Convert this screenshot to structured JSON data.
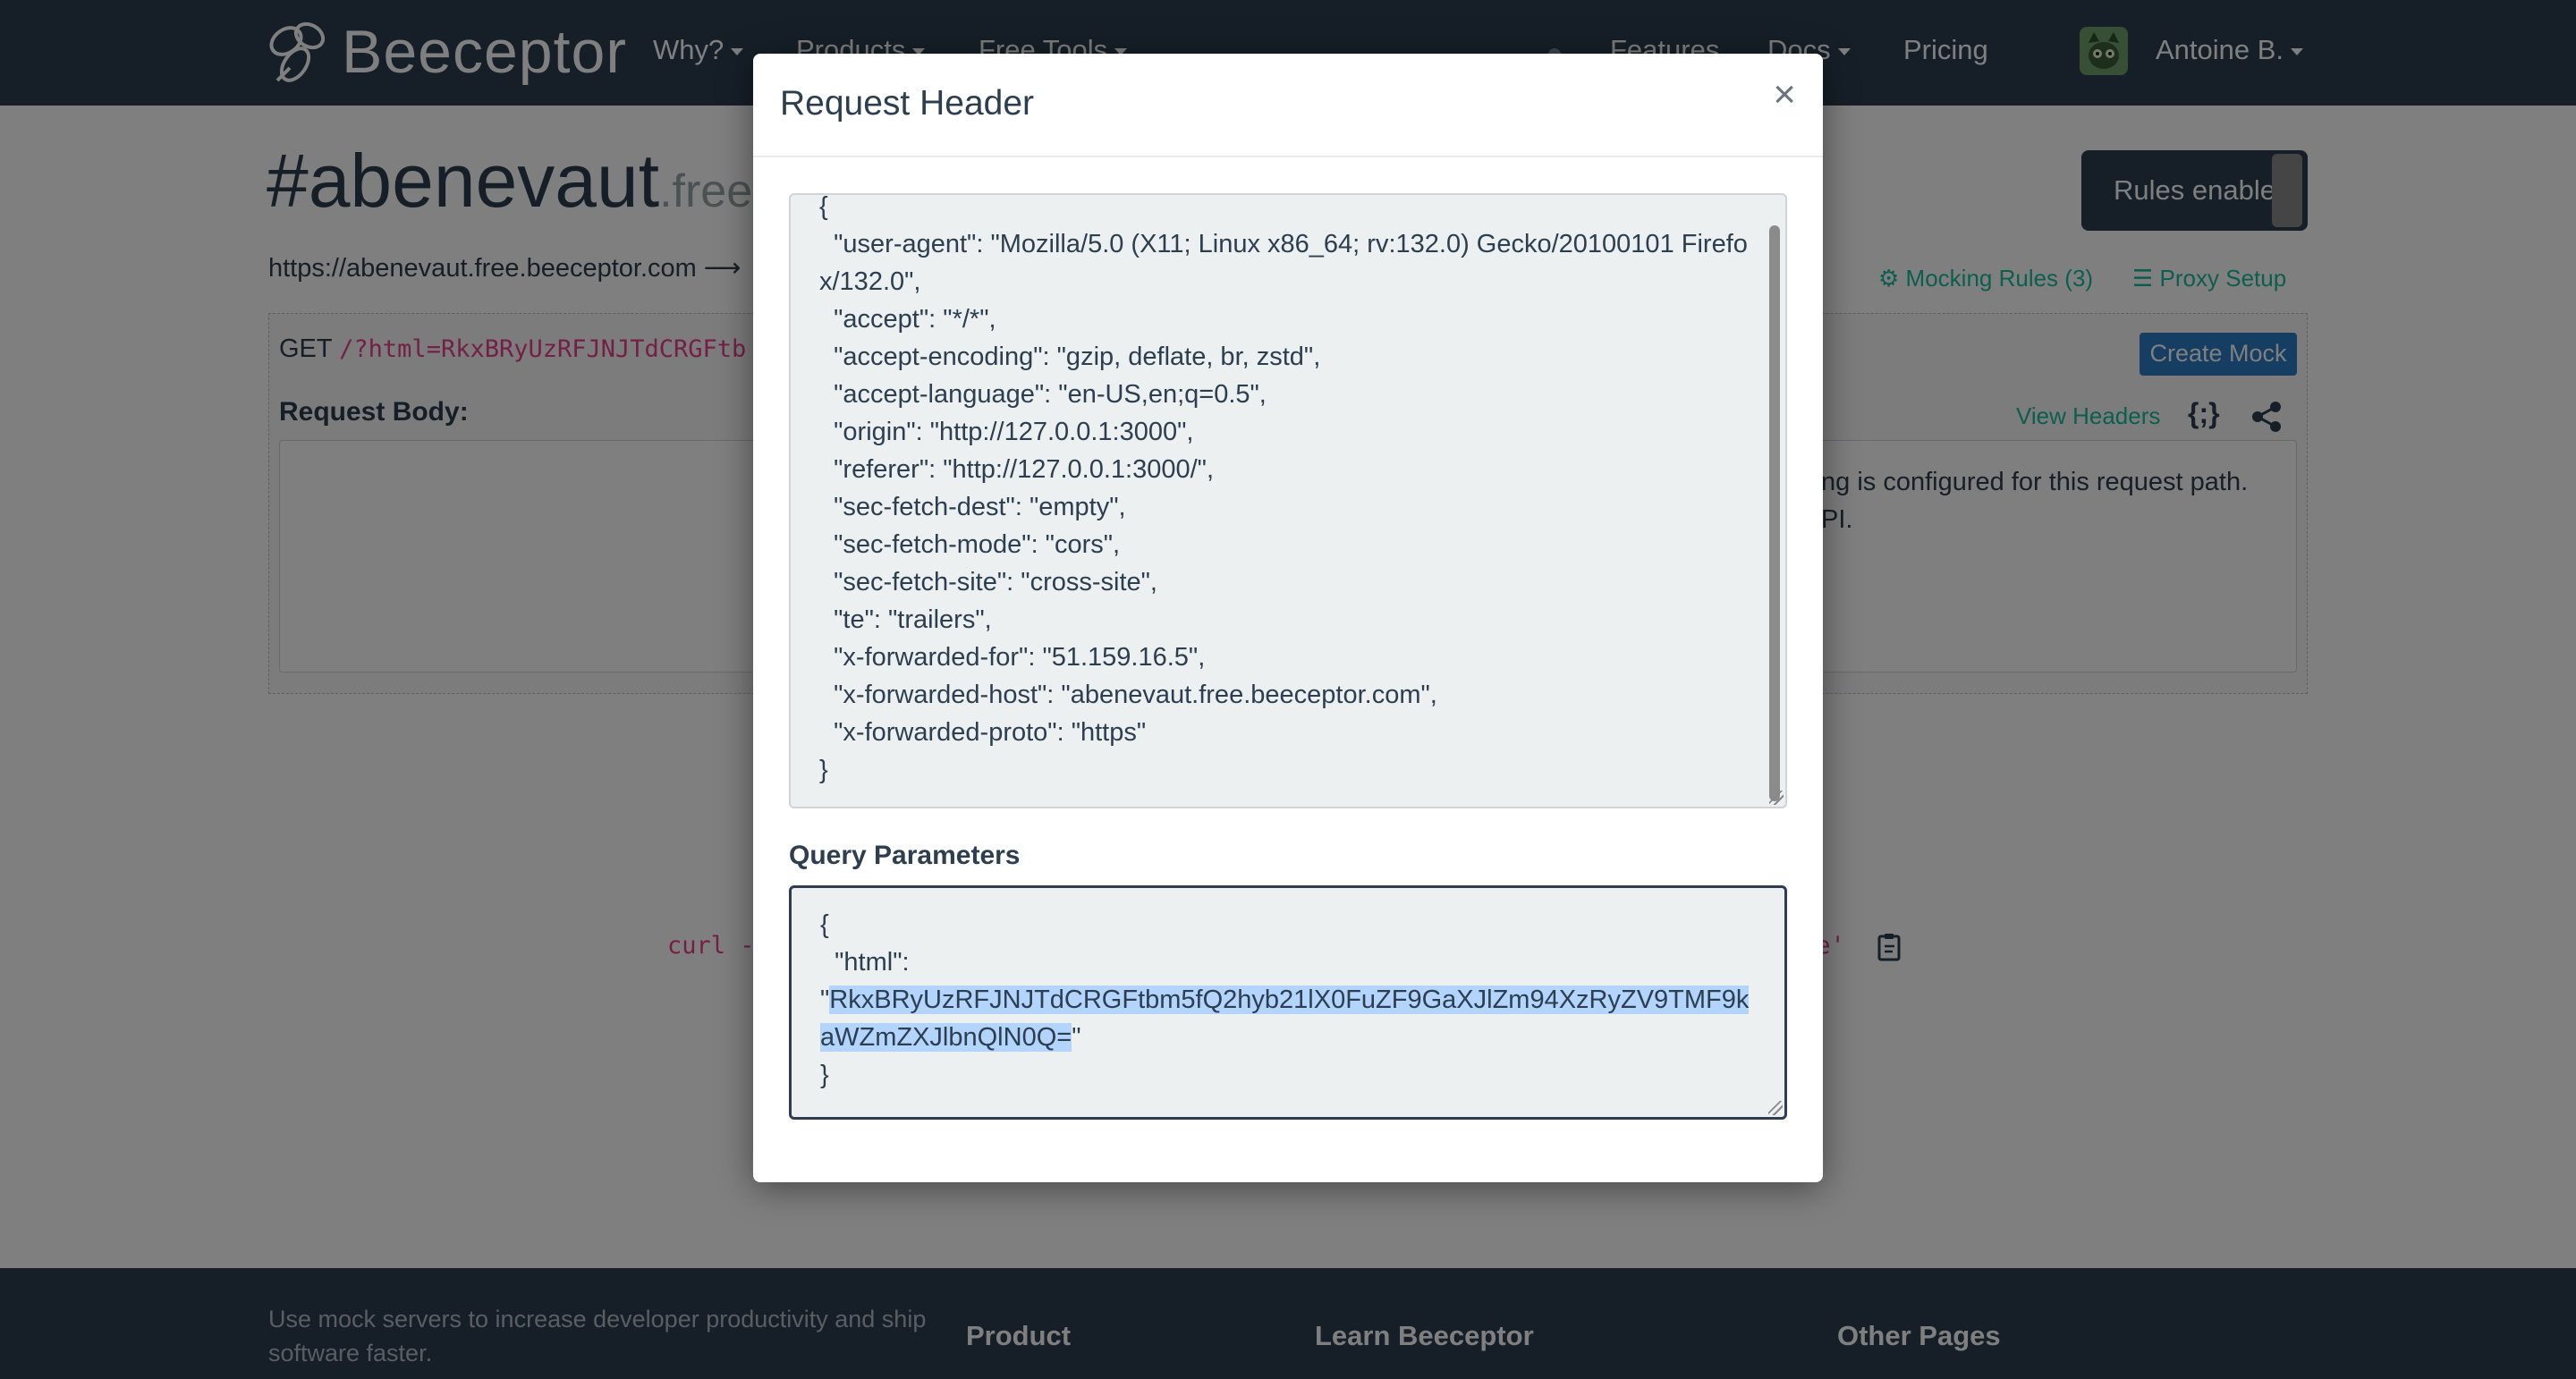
{
  "navbar": {
    "brand": "Beeceptor",
    "items": [
      {
        "label": "Why?",
        "dropdown": true
      },
      {
        "label": "Products",
        "dropdown": true
      },
      {
        "label": "Free Tools",
        "dropdown": true
      },
      {
        "label": "Features",
        "dropdown": false
      },
      {
        "label": "Docs",
        "dropdown": true
      },
      {
        "label": "Pricing",
        "dropdown": false
      }
    ],
    "user": "Antoine B."
  },
  "page": {
    "title": "#abenevaut",
    "title_suffix": ".free.b",
    "endpoint_url": "https://abenevaut.free.beeceptor.com",
    "rules_toggle": "Rules enabled",
    "mocking_rules": "Mocking Rules (3)",
    "proxy_setup": "Proxy Setup",
    "request_method": "GET",
    "request_path": "/?html=RkxBRyUzRFJNJTdCRGFtb",
    "create_mock": "Create Mock",
    "request_body_label": "Request Body:",
    "view_headers": "View Headers",
    "body_message_line1": "ng is configured for this request path.",
    "body_message_line2": "PI.",
    "curl_left": "curl -",
    "curl_right": "ue'"
  },
  "footer": {
    "tagline": "Use mock servers to increase developer productivity and ship software faster.",
    "columns": [
      "Product",
      "Learn Beeceptor",
      "Other Pages"
    ]
  },
  "modal": {
    "title": "Request Header",
    "close": "×",
    "headers_json": "{\n  \"user-agent\": \"Mozilla/5.0 (X11; Linux x86_64; rv:132.0) Gecko/20100101 Firefox/132.0\",\n  \"accept\": \"*/*\",\n  \"accept-encoding\": \"gzip, deflate, br, zstd\",\n  \"accept-language\": \"en-US,en;q=0.5\",\n  \"origin\": \"http://127.0.0.1:3000\",\n  \"referer\": \"http://127.0.0.1:3000/\",\n  \"sec-fetch-dest\": \"empty\",\n  \"sec-fetch-mode\": \"cors\",\n  \"sec-fetch-site\": \"cross-site\",\n  \"te\": \"trailers\",\n  \"x-forwarded-for\": \"51.159.16.5\",\n  \"x-forwarded-host\": \"abenevaut.free.beeceptor.com\",\n  \"x-forwarded-proto\": \"https\"\n}",
    "query_label": "Query Parameters",
    "query_open": "{\n  \"html\":\n\"",
    "query_value": "RkxBRyUzRFJNJTdCRGFtbm5fQ2hyb21lX0FuZF9GaXJlZm94XzRyZV9TMF9kaWZmZXJlbnQlN0Q=",
    "query_close": "\"\n}"
  }
}
